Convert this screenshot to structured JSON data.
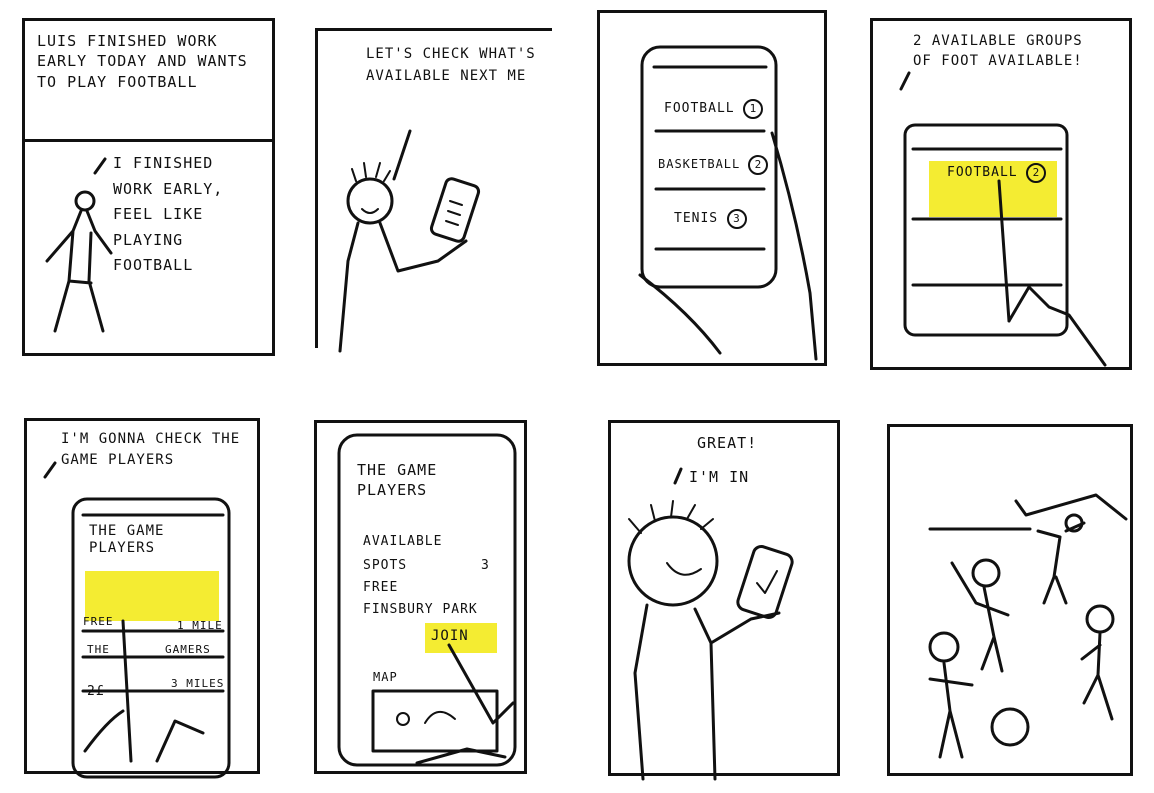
{
  "panels": [
    {
      "caption": "Luis finished work early today and wants to play football",
      "speech": "I finished work early, feel like playing football"
    },
    {
      "speech": "Let's check what's available next me"
    },
    {
      "phone": {
        "items": [
          {
            "label": "FOOTBALL",
            "count": "1"
          },
          {
            "label": "BASKETBALL",
            "count": "2"
          },
          {
            "label": "TENIS",
            "count": "3"
          }
        ]
      }
    },
    {
      "speech": "2 available groups of foot available!",
      "phone": {
        "row_label": "FOOTBALL",
        "row_count": "2"
      }
    },
    {
      "speech": "I'm gonna check the game players",
      "phone": {
        "title": "THE GAME PLAYERS",
        "row1_left": "FREE",
        "row1_right": "1 MILE",
        "row2_left": "THE",
        "row2_right": "GAMERS",
        "row3_left": "2£",
        "row3_right": "3 MILES"
      }
    },
    {
      "phone": {
        "title": "THE GAME PLAYERS",
        "line1": "AVAILABLE",
        "line2_left": "SPOTS",
        "line2_right": "3",
        "line3": "FREE",
        "line4": "FINSBURY PARK",
        "join_label": "JOIN",
        "map_label": "MAP"
      }
    },
    {
      "speech_1": "GREAT!",
      "speech_2": "I'M IN"
    },
    {}
  ],
  "highlight_color": "#f3ea1c"
}
